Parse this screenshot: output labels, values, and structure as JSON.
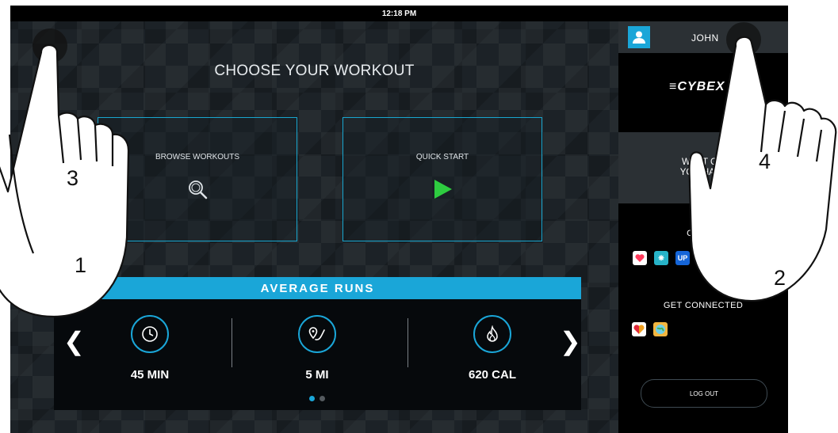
{
  "status": {
    "time": "12:18 PM"
  },
  "main": {
    "title": "CHOOSE YOUR WORKOUT",
    "tiles": [
      {
        "label": "BROWSE WORKOUTS",
        "icon": "search-icon"
      },
      {
        "label": "QUICK START",
        "icon": "play-icon"
      }
    ],
    "average_runs": {
      "heading": "AVERAGE RUNS",
      "stats": [
        {
          "value": "45 MIN",
          "icon": "clock-icon"
        },
        {
          "value": "5 MI",
          "icon": "route-pin-icon"
        },
        {
          "value": "620 CAL",
          "icon": "flame-icon"
        }
      ],
      "page_count": 2,
      "active_page": 1
    }
  },
  "sidebar": {
    "user_name": "JOHN",
    "brand": "CYBEX",
    "goal_text": "WHAT GO... YOU HAVE...",
    "goal_line1": "WHAT GO",
    "goal_line2": "YOU HAVE",
    "connected_label": "CONNE",
    "connected_apps": [
      "apple-health-icon",
      "fitbit-icon",
      "jawbone-up-icon",
      "runkeeper-icon"
    ],
    "get_connected_label": "GET CONNECTED",
    "available_apps": [
      "heart-app-icon",
      "globe-app-icon"
    ],
    "logout_label": "LOG OUT"
  },
  "annotations": {
    "numbers": [
      "1",
      "2",
      "3",
      "4"
    ]
  },
  "colors": {
    "accent": "#1aa6d8",
    "play": "#2ecc40",
    "background": "#1c2227"
  }
}
